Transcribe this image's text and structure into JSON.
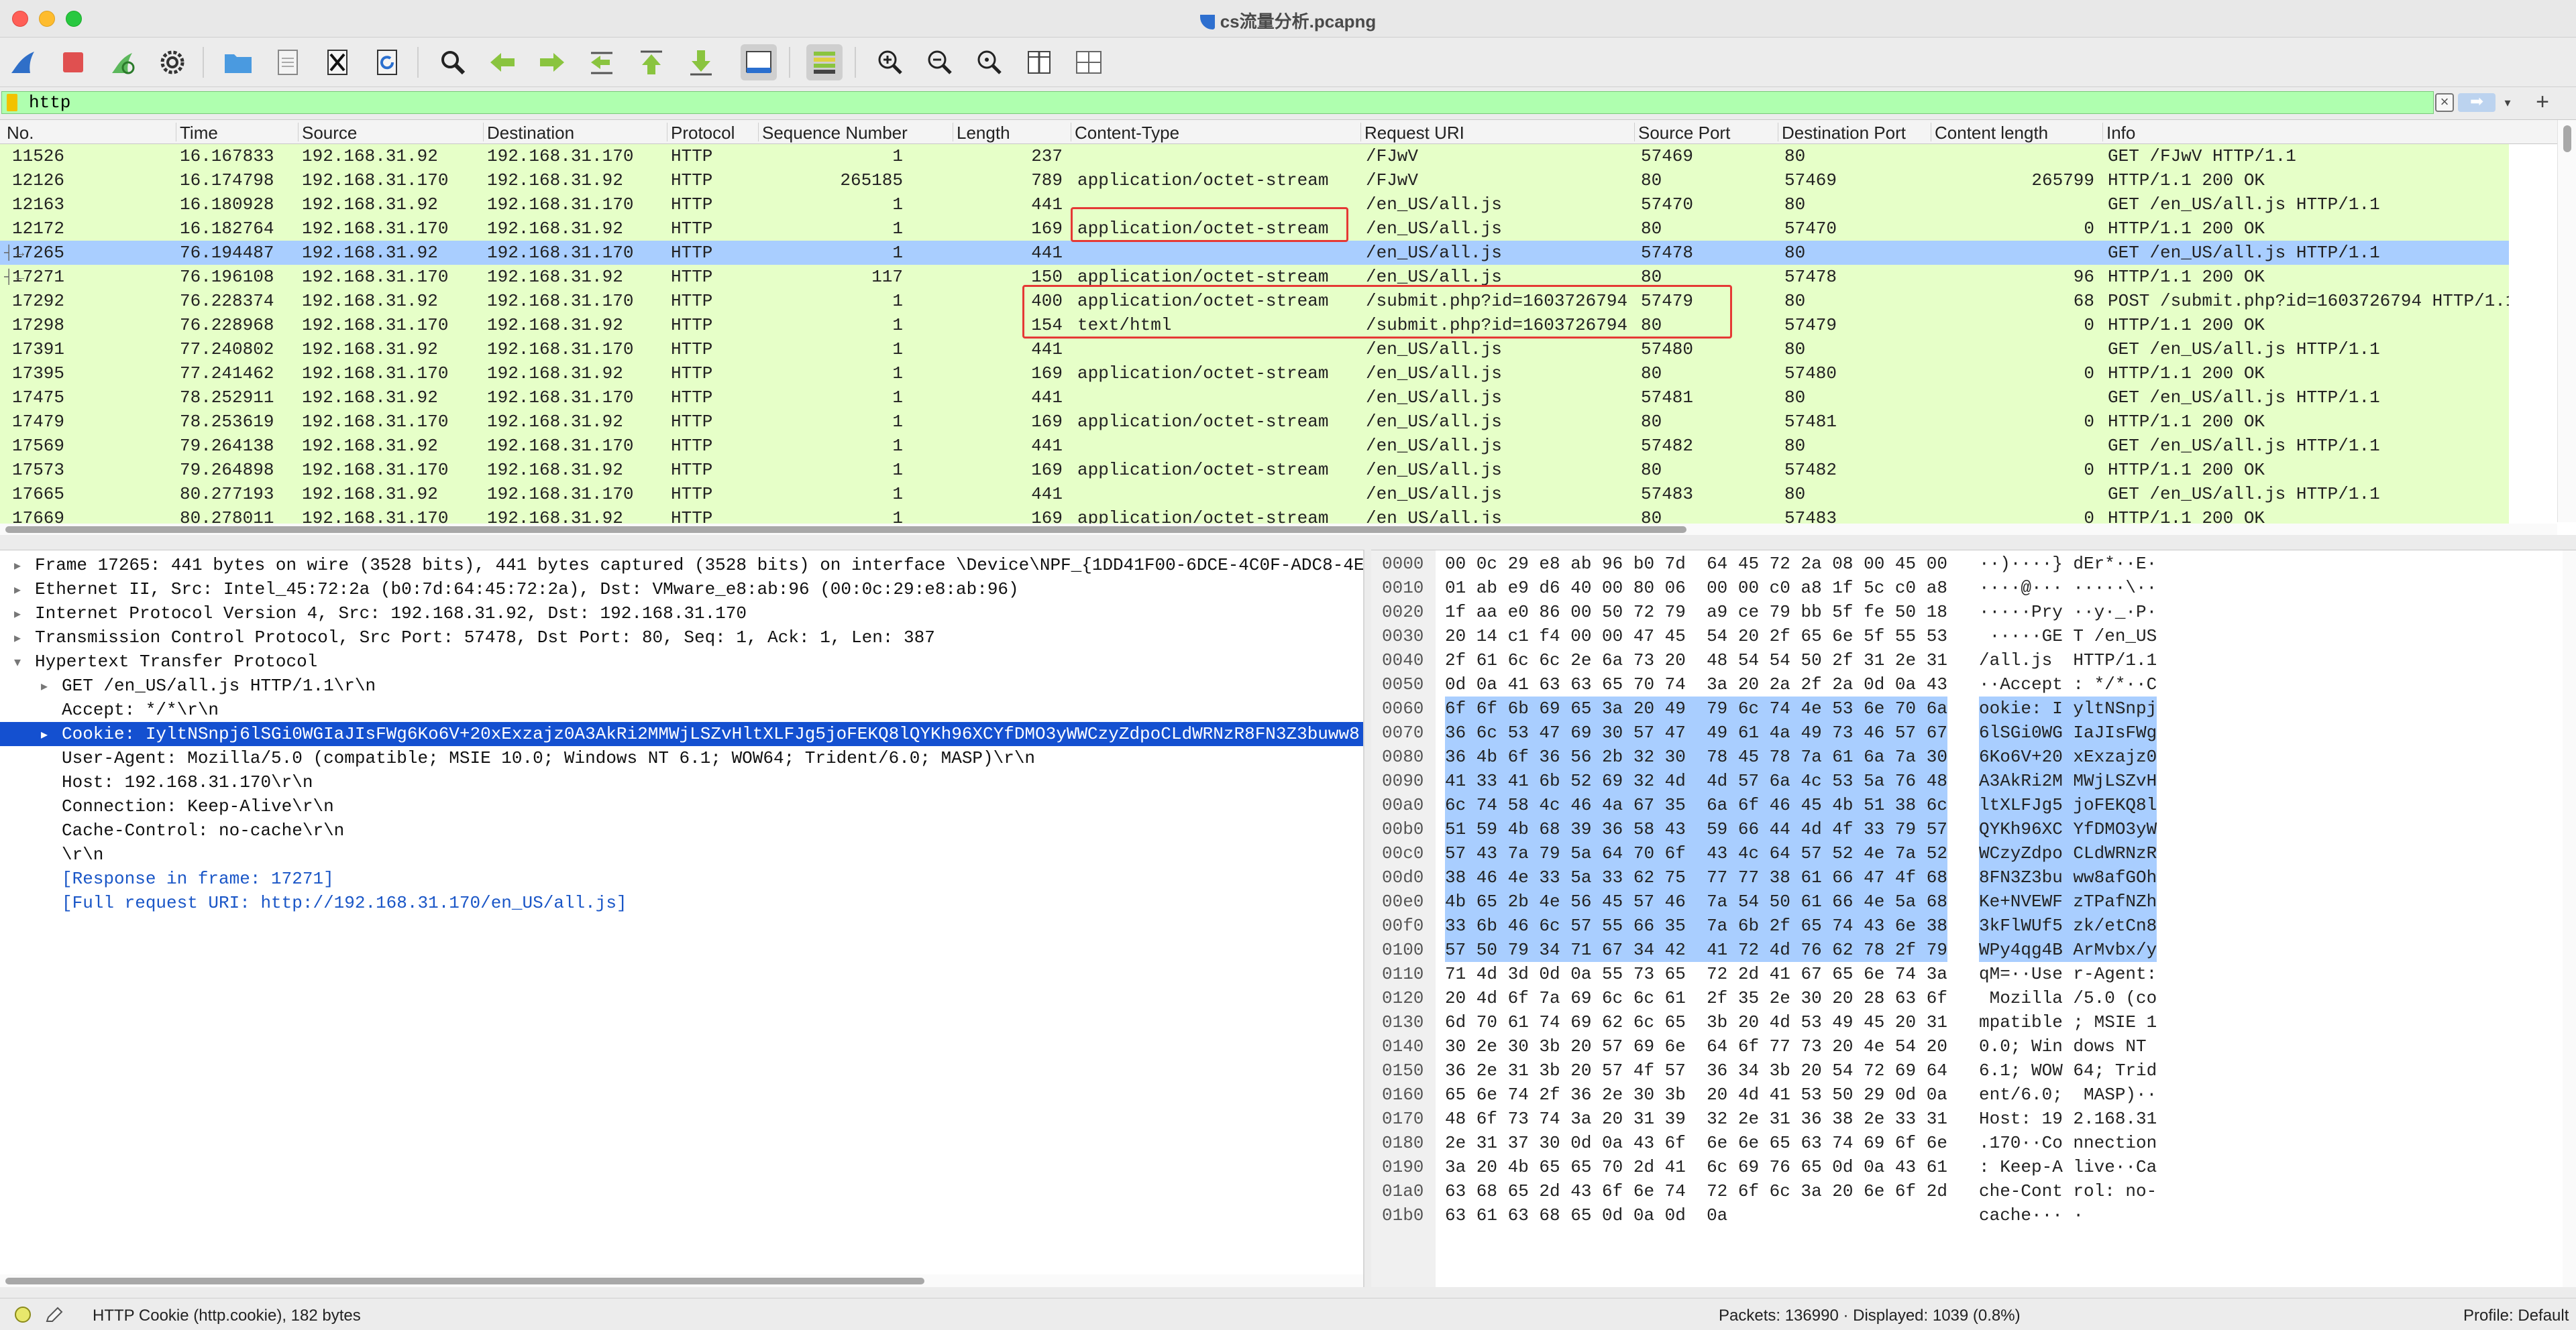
{
  "window": {
    "title": "cs流量分析.pcapng"
  },
  "toolbar": {
    "icons": [
      "shark-fin-icon",
      "stop-icon",
      "restart-icon",
      "options-gear-icon",
      "open-folder-icon",
      "save-file-icon",
      "close-file-icon",
      "reload-icon",
      "find-icon",
      "back-arrow-icon",
      "forward-arrow-icon",
      "go-to-packet-icon",
      "first-packet-icon",
      "last-packet-icon",
      "autoscroll-icon",
      "colorize-icon",
      "zoom-in-icon",
      "zoom-out-icon",
      "zoom-normal-icon",
      "resize-columns-icon",
      "columns-layout-icon"
    ]
  },
  "filter": {
    "value": "http"
  },
  "packet_list": {
    "columns": [
      "No.",
      "Time",
      "Source",
      "Destination",
      "Protocol",
      "Sequence Number",
      "Length",
      "Content-Type",
      "Request URI",
      "Source Port",
      "Destination Port",
      "Content length",
      "Info"
    ],
    "rows": [
      {
        "no": "11526",
        "time": "16.167833",
        "src": "192.168.31.92",
        "dst": "192.168.31.170",
        "proto": "HTTP",
        "seq": "1",
        "len": "237",
        "ctype": "",
        "uri": "/FJwV",
        "sport": "57469",
        "dport": "80",
        "clen": "",
        "info": "GET /FJwV HTTP/1.1"
      },
      {
        "no": "12126",
        "time": "16.174798",
        "src": "192.168.31.170",
        "dst": "192.168.31.92",
        "proto": "HTTP",
        "seq": "265185",
        "len": "789",
        "ctype": "application/octet-stream",
        "uri": "/FJwV",
        "sport": "80",
        "dport": "57469",
        "clen": "265799",
        "info": "HTTP/1.1 200 OK"
      },
      {
        "no": "12163",
        "time": "16.180928",
        "src": "192.168.31.92",
        "dst": "192.168.31.170",
        "proto": "HTTP",
        "seq": "1",
        "len": "441",
        "ctype": "",
        "uri": "/en_US/all.js",
        "sport": "57470",
        "dport": "80",
        "clen": "",
        "info": "GET /en_US/all.js HTTP/1.1"
      },
      {
        "no": "12172",
        "time": "16.182764",
        "src": "192.168.31.170",
        "dst": "192.168.31.92",
        "proto": "HTTP",
        "seq": "1",
        "len": "169",
        "ctype": "application/octet-stream",
        "uri": "/en_US/all.js",
        "sport": "80",
        "dport": "57470",
        "clen": "0",
        "info": "HTTP/1.1 200 OK"
      },
      {
        "no": "17265",
        "time": "76.194487",
        "src": "192.168.31.92",
        "dst": "192.168.31.170",
        "proto": "HTTP",
        "seq": "1",
        "len": "441",
        "ctype": "",
        "uri": "/en_US/all.js",
        "sport": "57478",
        "dport": "80",
        "clen": "",
        "info": "GET /en_US/all.js HTTP/1.1"
      },
      {
        "no": "17271",
        "time": "76.196108",
        "src": "192.168.31.170",
        "dst": "192.168.31.92",
        "proto": "HTTP",
        "seq": "117",
        "len": "150",
        "ctype": "application/octet-stream",
        "uri": "/en_US/all.js",
        "sport": "80",
        "dport": "57478",
        "clen": "96",
        "info": "HTTP/1.1 200 OK"
      },
      {
        "no": "17292",
        "time": "76.228374",
        "src": "192.168.31.92",
        "dst": "192.168.31.170",
        "proto": "HTTP",
        "seq": "1",
        "len": "400",
        "ctype": "application/octet-stream",
        "uri": "/submit.php?id=1603726794",
        "sport": "57479",
        "dport": "80",
        "clen": "68",
        "info": "POST /submit.php?id=1603726794 HTTP/1.1"
      },
      {
        "no": "17298",
        "time": "76.228968",
        "src": "192.168.31.170",
        "dst": "192.168.31.92",
        "proto": "HTTP",
        "seq": "1",
        "len": "154",
        "ctype": "text/html",
        "uri": "/submit.php?id=1603726794",
        "sport": "80",
        "dport": "57479",
        "clen": "0",
        "info": "HTTP/1.1 200 OK"
      },
      {
        "no": "17391",
        "time": "77.240802",
        "src": "192.168.31.92",
        "dst": "192.168.31.170",
        "proto": "HTTP",
        "seq": "1",
        "len": "441",
        "ctype": "",
        "uri": "/en_US/all.js",
        "sport": "57480",
        "dport": "80",
        "clen": "",
        "info": "GET /en_US/all.js HTTP/1.1"
      },
      {
        "no": "17395",
        "time": "77.241462",
        "src": "192.168.31.170",
        "dst": "192.168.31.92",
        "proto": "HTTP",
        "seq": "1",
        "len": "169",
        "ctype": "application/octet-stream",
        "uri": "/en_US/all.js",
        "sport": "80",
        "dport": "57480",
        "clen": "0",
        "info": "HTTP/1.1 200 OK"
      },
      {
        "no": "17475",
        "time": "78.252911",
        "src": "192.168.31.92",
        "dst": "192.168.31.170",
        "proto": "HTTP",
        "seq": "1",
        "len": "441",
        "ctype": "",
        "uri": "/en_US/all.js",
        "sport": "57481",
        "dport": "80",
        "clen": "",
        "info": "GET /en_US/all.js HTTP/1.1"
      },
      {
        "no": "17479",
        "time": "78.253619",
        "src": "192.168.31.170",
        "dst": "192.168.31.92",
        "proto": "HTTP",
        "seq": "1",
        "len": "169",
        "ctype": "application/octet-stream",
        "uri": "/en_US/all.js",
        "sport": "80",
        "dport": "57481",
        "clen": "0",
        "info": "HTTP/1.1 200 OK"
      },
      {
        "no": "17569",
        "time": "79.264138",
        "src": "192.168.31.92",
        "dst": "192.168.31.170",
        "proto": "HTTP",
        "seq": "1",
        "len": "441",
        "ctype": "",
        "uri": "/en_US/all.js",
        "sport": "57482",
        "dport": "80",
        "clen": "",
        "info": "GET /en_US/all.js HTTP/1.1"
      },
      {
        "no": "17573",
        "time": "79.264898",
        "src": "192.168.31.170",
        "dst": "192.168.31.92",
        "proto": "HTTP",
        "seq": "1",
        "len": "169",
        "ctype": "application/octet-stream",
        "uri": "/en_US/all.js",
        "sport": "80",
        "dport": "57482",
        "clen": "0",
        "info": "HTTP/1.1 200 OK"
      },
      {
        "no": "17665",
        "time": "80.277193",
        "src": "192.168.31.92",
        "dst": "192.168.31.170",
        "proto": "HTTP",
        "seq": "1",
        "len": "441",
        "ctype": "",
        "uri": "/en_US/all.js",
        "sport": "57483",
        "dport": "80",
        "clen": "",
        "info": "GET /en_US/all.js HTTP/1.1"
      },
      {
        "no": "17669",
        "time": "80.278011",
        "src": "192.168.31.170",
        "dst": "192.168.31.92",
        "proto": "HTTP",
        "seq": "1",
        "len": "169",
        "ctype": "application/octet-stream",
        "uri": "/en_US/all.js",
        "sport": "80",
        "dport": "57483",
        "clen": "0",
        "info": "HTTP/1.1 200 OK"
      }
    ],
    "selected_no": "17265",
    "row_color": "#e6ffc8",
    "selected_color": "#a9ceff"
  },
  "details": {
    "rows": [
      {
        "text": "Frame 17265: 441 bytes on wire (3528 bits), 441 bytes captured (3528 bits) on interface \\Device\\NPF_{1DD41F00-6DCE-4C0F-ADC8-4E",
        "arrow": "▸",
        "indent": 0
      },
      {
        "text": "Ethernet II, Src: Intel_45:72:2a (b0:7d:64:45:72:2a), Dst: VMware_e8:ab:96 (00:0c:29:e8:ab:96)",
        "arrow": "▸",
        "indent": 0
      },
      {
        "text": "Internet Protocol Version 4, Src: 192.168.31.92, Dst: 192.168.31.170",
        "arrow": "▸",
        "indent": 0
      },
      {
        "text": "Transmission Control Protocol, Src Port: 57478, Dst Port: 80, Seq: 1, Ack: 1, Len: 387",
        "arrow": "▸",
        "indent": 0
      },
      {
        "text": "Hypertext Transfer Protocol",
        "arrow": "▾",
        "indent": 0
      },
      {
        "text": "GET /en_US/all.js HTTP/1.1\\r\\n",
        "arrow": "▸",
        "indent": 1
      },
      {
        "text": "Accept: */*\\r\\n",
        "arrow": "",
        "indent": 1
      },
      {
        "text": "Cookie: IyltNSnpj6lSGi0WGIaJIsFWg6Ko6V+20xExzajz0A3AkRi2MMWjLSZvHltXLFJg5joFEKQ8lQYKh96XCYfDMO3yWWCzyZdpoCLdWRNzR8FN3Z3buww8",
        "arrow": "▸",
        "indent": 1
      },
      {
        "text": "User-Agent: Mozilla/5.0 (compatible; MSIE 10.0; Windows NT 6.1; WOW64; Trident/6.0; MASP)\\r\\n",
        "arrow": "",
        "indent": 1
      },
      {
        "text": "Host: 192.168.31.170\\r\\n",
        "arrow": "",
        "indent": 1
      },
      {
        "text": "Connection: Keep-Alive\\r\\n",
        "arrow": "",
        "indent": 1
      },
      {
        "text": "Cache-Control: no-cache\\r\\n",
        "arrow": "",
        "indent": 1
      },
      {
        "text": "\\r\\n",
        "arrow": "",
        "indent": 1
      },
      {
        "text": "[Response in frame: 17271]",
        "arrow": "",
        "indent": 1,
        "link": true
      },
      {
        "text": "[Full request URI: http://192.168.31.170/en_US/all.js]",
        "arrow": "",
        "indent": 1,
        "link": true
      }
    ],
    "selected_index": 7
  },
  "bytes": {
    "rows": [
      {
        "off": "0000",
        "hex": "00 0c 29 e8 ab 96 b0 7d  64 45 72 2a 08 00 45 00",
        "asc": "··)····} dEr*··E·"
      },
      {
        "off": "0010",
        "hex": "01 ab e9 d6 40 00 80 06  00 00 c0 a8 1f 5c c0 a8",
        "asc": "····@··· ·····\\··"
      },
      {
        "off": "0020",
        "hex": "1f aa e0 86 00 50 72 79  a9 ce 79 bb 5f fe 50 18",
        "asc": "·····Pry ··y·_·P·"
      },
      {
        "off": "0030",
        "hex": "20 14 c1 f4 00 00 47 45  54 20 2f 65 6e 5f 55 53",
        "asc": " ·····GE T /en_US"
      },
      {
        "off": "0040",
        "hex": "2f 61 6c 6c 2e 6a 73 20  48 54 54 50 2f 31 2e 31",
        "asc": "/all.js  HTTP/1.1"
      },
      {
        "off": "0050",
        "hex": "0d 0a 41 63 63 65 70 74  3a 20 2a 2f 2a 0d 0a 43",
        "asc": "··Accept : */*··C"
      },
      {
        "off": "0060",
        "hex": "6f 6f 6b 69 65 3a 20 49  79 6c 74 4e 53 6e 70 6a",
        "asc": "ookie: I yltNSnpj"
      },
      {
        "off": "0070",
        "hex": "36 6c 53 47 69 30 57 47  49 61 4a 49 73 46 57 67",
        "asc": "6lSGi0WG IaJIsFWg"
      },
      {
        "off": "0080",
        "hex": "36 4b 6f 36 56 2b 32 30  78 45 78 7a 61 6a 7a 30",
        "asc": "6Ko6V+20 xExzajz0"
      },
      {
        "off": "0090",
        "hex": "41 33 41 6b 52 69 32 4d  4d 57 6a 4c 53 5a 76 48",
        "asc": "A3AkRi2M MWjLSZvH"
      },
      {
        "off": "00a0",
        "hex": "6c 74 58 4c 46 4a 67 35  6a 6f 46 45 4b 51 38 6c",
        "asc": "ltXLFJg5 joFEKQ8l"
      },
      {
        "off": "00b0",
        "hex": "51 59 4b 68 39 36 58 43  59 66 44 4d 4f 33 79 57",
        "asc": "QYKh96XC YfDMO3yW"
      },
      {
        "off": "00c0",
        "hex": "57 43 7a 79 5a 64 70 6f  43 4c 64 57 52 4e 7a 52",
        "asc": "WCzyZdpo CLdWRNzR"
      },
      {
        "off": "00d0",
        "hex": "38 46 4e 33 5a 33 62 75  77 77 38 61 66 47 4f 68",
        "asc": "8FN3Z3bu ww8afGOh"
      },
      {
        "off": "00e0",
        "hex": "4b 65 2b 4e 56 45 57 46  7a 54 50 61 66 4e 5a 68",
        "asc": "Ke+NVEWF zTPafNZh"
      },
      {
        "off": "00f0",
        "hex": "33 6b 46 6c 57 55 66 35  7a 6b 2f 65 74 43 6e 38",
        "asc": "3kFlWUf5 zk/etCn8"
      },
      {
        "off": "0100",
        "hex": "57 50 79 34 71 67 34 42  41 72 4d 76 62 78 2f 79",
        "asc": "WPy4qg4B ArMvbx/y"
      },
      {
        "off": "0110",
        "hex": "71 4d 3d 0d 0a 55 73 65  72 2d 41 67 65 6e 74 3a",
        "asc": "qM=··Use r-Agent:"
      },
      {
        "off": "0120",
        "hex": "20 4d 6f 7a 69 6c 6c 61  2f 35 2e 30 20 28 63 6f",
        "asc": " Mozilla /5.0 (co"
      },
      {
        "off": "0130",
        "hex": "6d 70 61 74 69 62 6c 65  3b 20 4d 53 49 45 20 31",
        "asc": "mpatible ; MSIE 1"
      },
      {
        "off": "0140",
        "hex": "30 2e 30 3b 20 57 69 6e  64 6f 77 73 20 4e 54 20",
        "asc": "0.0; Win dows NT "
      },
      {
        "off": "0150",
        "hex": "36 2e 31 3b 20 57 4f 57  36 34 3b 20 54 72 69 64",
        "asc": "6.1; WOW 64; Trid"
      },
      {
        "off": "0160",
        "hex": "65 6e 74 2f 36 2e 30 3b  20 4d 41 53 50 29 0d 0a",
        "asc": "ent/6.0;  MASP)··"
      },
      {
        "off": "0170",
        "hex": "48 6f 73 74 3a 20 31 39  32 2e 31 36 38 2e 33 31",
        "asc": "Host: 19 2.168.31"
      },
      {
        "off": "0180",
        "hex": "2e 31 37 30 0d 0a 43 6f  6e 6e 65 63 74 69 6f 6e",
        "asc": ".170··Co nnection"
      },
      {
        "off": "0190",
        "hex": "3a 20 4b 65 65 70 2d 41  6c 69 76 65 0d 0a 43 61",
        "asc": ": Keep-A live··Ca"
      },
      {
        "off": "01a0",
        "hex": "63 68 65 2d 43 6f 6e 74  72 6f 6c 3a 20 6e 6f 2d",
        "asc": "che-Cont rol: no-"
      },
      {
        "off": "01b0",
        "hex": "63 61 63 68 65 0d 0a 0d  0a",
        "asc": "cache··· ·"
      }
    ]
  },
  "status": {
    "field_info": "HTTP Cookie (http.cookie), 182 bytes",
    "packets": "Packets: 136990 · Displayed: 1039 (0.8%)",
    "profile": "Profile: Default"
  }
}
